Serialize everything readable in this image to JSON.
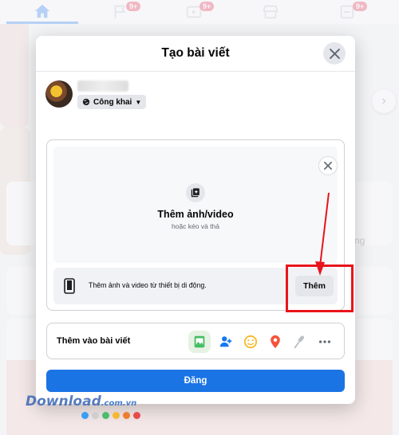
{
  "nav": {
    "badges": [
      "9+",
      "9+",
      "9+"
    ]
  },
  "background": {
    "right_text": "ng"
  },
  "modal": {
    "title": "Tạo bài viết",
    "privacy_label": "Công khai",
    "upload_title": "Thêm ảnh/video",
    "upload_subtitle": "hoặc kéo và thả",
    "mobile_text": "Thêm ảnh và video từ thiết bị di động.",
    "mobile_add_button": "Thêm",
    "add_to_post_label": "Thêm vào bài viết",
    "post_button": "Đăng",
    "tools": [
      "photo-video-icon",
      "tag-people-icon",
      "feeling-icon",
      "check-in-icon",
      "live-video-icon",
      "more-icon"
    ]
  },
  "colors": {
    "accent": "#1b74e4",
    "highlight": "#e8141b",
    "photo_green": "#45bd62",
    "tag_blue": "#1877f2",
    "feeling_yellow": "#f7b928",
    "location_red": "#f5533d"
  },
  "watermark": {
    "text": "Download",
    "domain": ".com.vn",
    "dot_colors": [
      "#3b9ef5",
      "#cfcfcf",
      "#4dbb6e",
      "#f5b832",
      "#f07d2f",
      "#e84b4b"
    ]
  }
}
